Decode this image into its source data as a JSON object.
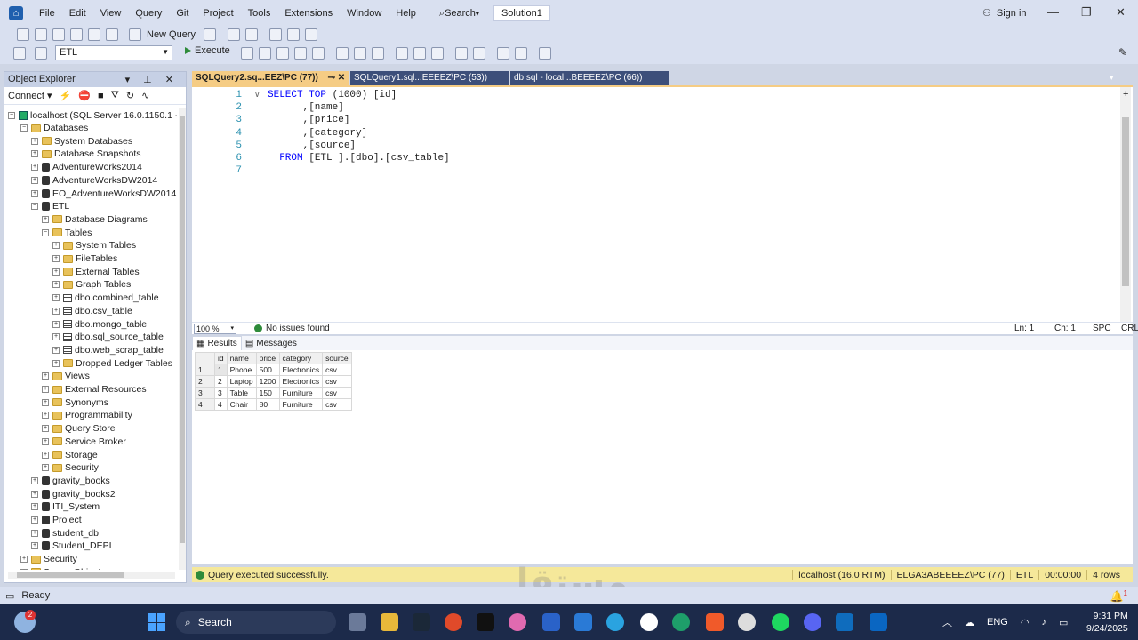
{
  "menubar": {
    "items": [
      "File",
      "Edit",
      "View",
      "Query",
      "Git",
      "Project",
      "Tools",
      "Extensions",
      "Window",
      "Help"
    ],
    "search_label": "Search",
    "solution": "Solution1",
    "signin": "Sign in"
  },
  "toolbar": {
    "new_query": "New Query",
    "database": "ETL",
    "execute": "Execute"
  },
  "object_explorer": {
    "title": "Object Explorer",
    "connect": "Connect",
    "server": "localhost (SQL Server 16.0.1150.1 - ELG",
    "tree": [
      {
        "label": "Databases",
        "level": 1,
        "exp": "-",
        "icon": "folder"
      },
      {
        "label": "System Databases",
        "level": 2,
        "exp": "+",
        "icon": "folder"
      },
      {
        "label": "Database Snapshots",
        "level": 2,
        "exp": "+",
        "icon": "folder"
      },
      {
        "label": "AdventureWorks2014",
        "level": 2,
        "exp": "+",
        "icon": "db"
      },
      {
        "label": "AdventureWorksDW2014",
        "level": 2,
        "exp": "+",
        "icon": "db"
      },
      {
        "label": "EO_AdventureWorksDW2014",
        "level": 2,
        "exp": "+",
        "icon": "db"
      },
      {
        "label": "ETL",
        "level": 2,
        "exp": "-",
        "icon": "db"
      },
      {
        "label": "Database Diagrams",
        "level": 3,
        "exp": "+",
        "icon": "folder"
      },
      {
        "label": "Tables",
        "level": 3,
        "exp": "-",
        "icon": "folder"
      },
      {
        "label": "System Tables",
        "level": 4,
        "exp": "+",
        "icon": "folder"
      },
      {
        "label": "FileTables",
        "level": 4,
        "exp": "+",
        "icon": "folder"
      },
      {
        "label": "External Tables",
        "level": 4,
        "exp": "+",
        "icon": "folder"
      },
      {
        "label": "Graph Tables",
        "level": 4,
        "exp": "+",
        "icon": "folder"
      },
      {
        "label": "dbo.combined_table",
        "level": 4,
        "exp": "+",
        "icon": "table"
      },
      {
        "label": "dbo.csv_table",
        "level": 4,
        "exp": "+",
        "icon": "table"
      },
      {
        "label": "dbo.mongo_table",
        "level": 4,
        "exp": "+",
        "icon": "table"
      },
      {
        "label": "dbo.sql_source_table",
        "level": 4,
        "exp": "+",
        "icon": "table"
      },
      {
        "label": "dbo.web_scrap_table",
        "level": 4,
        "exp": "+",
        "icon": "table"
      },
      {
        "label": "Dropped Ledger Tables",
        "level": 4,
        "exp": "+",
        "icon": "folder"
      },
      {
        "label": "Views",
        "level": 3,
        "exp": "+",
        "icon": "folder"
      },
      {
        "label": "External Resources",
        "level": 3,
        "exp": "+",
        "icon": "folder"
      },
      {
        "label": "Synonyms",
        "level": 3,
        "exp": "+",
        "icon": "folder"
      },
      {
        "label": "Programmability",
        "level": 3,
        "exp": "+",
        "icon": "folder"
      },
      {
        "label": "Query Store",
        "level": 3,
        "exp": "+",
        "icon": "folder"
      },
      {
        "label": "Service Broker",
        "level": 3,
        "exp": "+",
        "icon": "folder"
      },
      {
        "label": "Storage",
        "level": 3,
        "exp": "+",
        "icon": "folder"
      },
      {
        "label": "Security",
        "level": 3,
        "exp": "+",
        "icon": "folder"
      },
      {
        "label": "gravity_books",
        "level": 2,
        "exp": "+",
        "icon": "db"
      },
      {
        "label": "gravity_books2",
        "level": 2,
        "exp": "+",
        "icon": "db"
      },
      {
        "label": "ITI_System",
        "level": 2,
        "exp": "+",
        "icon": "db"
      },
      {
        "label": "Project",
        "level": 2,
        "exp": "+",
        "icon": "db"
      },
      {
        "label": "student_db",
        "level": 2,
        "exp": "+",
        "icon": "db"
      },
      {
        "label": "Student_DEPI",
        "level": 2,
        "exp": "+",
        "icon": "db"
      },
      {
        "label": "Security",
        "level": 1,
        "exp": "+",
        "icon": "folder"
      },
      {
        "label": "Server Objects",
        "level": 1,
        "exp": "+",
        "icon": "folder"
      }
    ]
  },
  "tabs": [
    {
      "label": "SQLQuery2.sq...EEZ\\PC (77))",
      "active": true
    },
    {
      "label": "SQLQuery1.sql...EEEEZ\\PC (53))",
      "active": false
    },
    {
      "label": "db.sql - local...BEEEEZ\\PC (66))",
      "active": false
    }
  ],
  "editor": {
    "lines": [
      {
        "n": "1",
        "kw": "SELECT TOP ",
        "rest": "(1000) [id]"
      },
      {
        "n": "2",
        "kw": "",
        "rest": "      ,[name]"
      },
      {
        "n": "3",
        "kw": "",
        "rest": "      ,[price]"
      },
      {
        "n": "4",
        "kw": "",
        "rest": "      ,[category]"
      },
      {
        "n": "5",
        "kw": "",
        "rest": "      ,[source]"
      },
      {
        "n": "6",
        "kw": "  FROM ",
        "rest": "[ETL ].[dbo].[csv_table]"
      },
      {
        "n": "7",
        "kw": "",
        "rest": ""
      }
    ]
  },
  "editor_status": {
    "zoom": "100 %",
    "issues": "No issues found",
    "ln": "Ln: 1",
    "ch": "Ch: 1",
    "spc": "SPC",
    "crlf": "CRLF"
  },
  "results": {
    "tab_results": "Results",
    "tab_messages": "Messages",
    "columns": [
      "id",
      "name",
      "price",
      "category",
      "source"
    ],
    "rows": [
      [
        "1",
        "1",
        "Phone",
        "500",
        "Electronics",
        "csv"
      ],
      [
        "2",
        "2",
        "Laptop",
        "1200",
        "Electronics",
        "csv"
      ],
      [
        "3",
        "3",
        "Table",
        "150",
        "Furniture",
        "csv"
      ],
      [
        "4",
        "4",
        "Chair",
        "80",
        "Furniture",
        "csv"
      ]
    ]
  },
  "query_status": {
    "message": "Query executed successfully.",
    "server": "localhost (16.0 RTM)",
    "user": "ELGA3ABEEEEZ\\PC (77)",
    "db": "ETL",
    "time": "00:00:00",
    "rows": "4 rows"
  },
  "statusbar": {
    "text": "Ready",
    "notif_count": "1"
  },
  "taskbar": {
    "weather_badge": "2",
    "search": "Search",
    "lang": "ENG",
    "time": "9:31 PM",
    "date": "9/24/2025"
  },
  "watermark": {
    "text": "مستقل",
    "sub": "mostaql.com"
  },
  "colors": {
    "accent_tab": "#f5cc84",
    "status_bar": "#f5e89a",
    "taskbar": "#1c2a4a"
  }
}
